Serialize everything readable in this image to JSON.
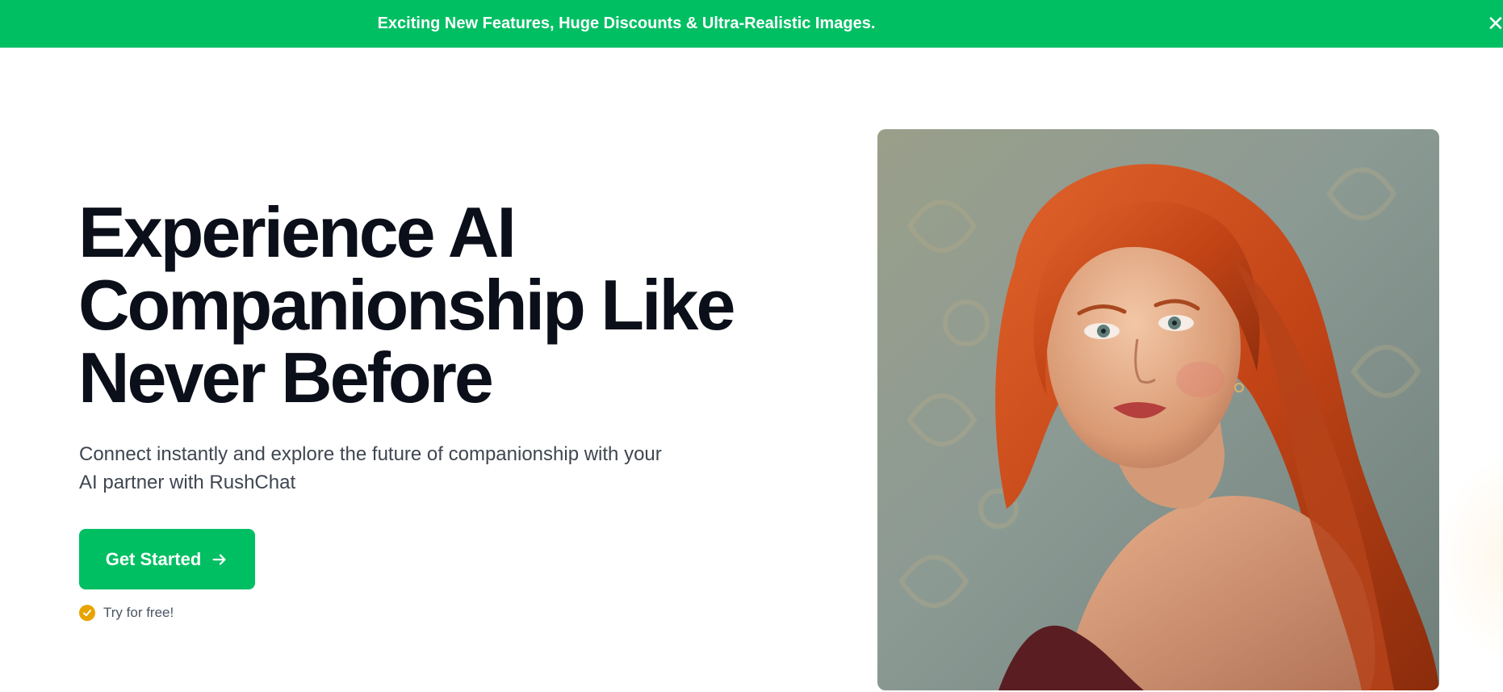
{
  "announcement": {
    "text": "Exciting New Features, Huge Discounts & Ultra-Realistic Images.",
    "close_icon": "close-icon"
  },
  "hero": {
    "title_lines": [
      "Experience AI",
      "Companionship Like",
      "Never Before"
    ],
    "subtitle_lines": [
      "Connect instantly and explore the future of companionship with your",
      "AI partner with RushChat"
    ],
    "cta_label": "Get Started",
    "cta_icon": "arrow-right-icon",
    "free_note": "Try for free!",
    "free_icon": "check-circle-icon"
  },
  "image": {
    "subject": "portrait-photo",
    "description_icon": "hero-portrait-image"
  },
  "colors": {
    "brand_green": "#00bf63",
    "heading": "#0b0f1a",
    "body_text": "#3f4650",
    "check_badge": "#e8a300",
    "background": "#ffffff"
  }
}
